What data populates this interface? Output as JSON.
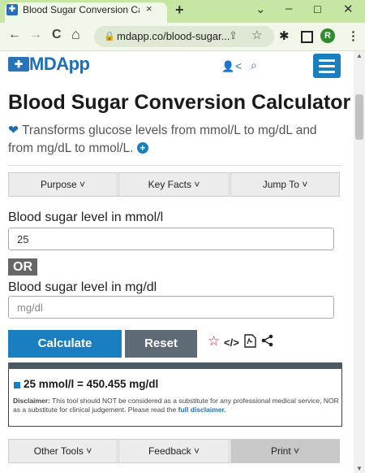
{
  "browser": {
    "tab_title": "Blood Sugar Conversion Calculat",
    "tab_close": "×",
    "new_tab": "+",
    "url": "mdapp.co/blood-sugar...",
    "profile_initial": "R",
    "window_controls": {
      "minimize": "–",
      "maximize": "☐",
      "close": "✕",
      "dropdown": "⌄"
    },
    "nav": {
      "back": "←",
      "forward": "→",
      "reload": "C",
      "home": "⌂"
    }
  },
  "site": {
    "logo_mark": "✚",
    "logo_text": "MDApp"
  },
  "page": {
    "title": "Blood Sugar Conversion Calculator",
    "subtitle": "Transforms glucose levels from mmol/L to mg/dL and from mg/dL to mmol/L."
  },
  "top_tabs": [
    {
      "label": "Purpose ˅"
    },
    {
      "label": "Key Facts ˅"
    },
    {
      "label": "Jump To ˅"
    }
  ],
  "form": {
    "mmol_label": "Blood sugar level in mmol/l",
    "mmol_value": "25",
    "or_label": "OR",
    "mgdl_label": "Blood sugar level in mg/dl",
    "mgdl_placeholder": "mg/dl"
  },
  "buttons": {
    "calculate": "Calculate",
    "reset": "Reset"
  },
  "result": {
    "text": "25 mmol/l = 450.455 mg/dl",
    "disclaimer_label": "Disclaimer:",
    "disclaimer_text": " This tool should NOT be considered as a substitute for any professional medical service, NOR as a substitute for clinical judgement. Please read the ",
    "disclaimer_link": "full disclaimer."
  },
  "bottom_tabs": [
    {
      "label": "Other Tools ˅"
    },
    {
      "label": "Feedback ˅"
    },
    {
      "label": "Print ˅"
    }
  ],
  "colors": {
    "brand_blue": "#1a7fc1",
    "reset_gray": "#5e6a75",
    "browser_green": "#c8e6a3"
  }
}
